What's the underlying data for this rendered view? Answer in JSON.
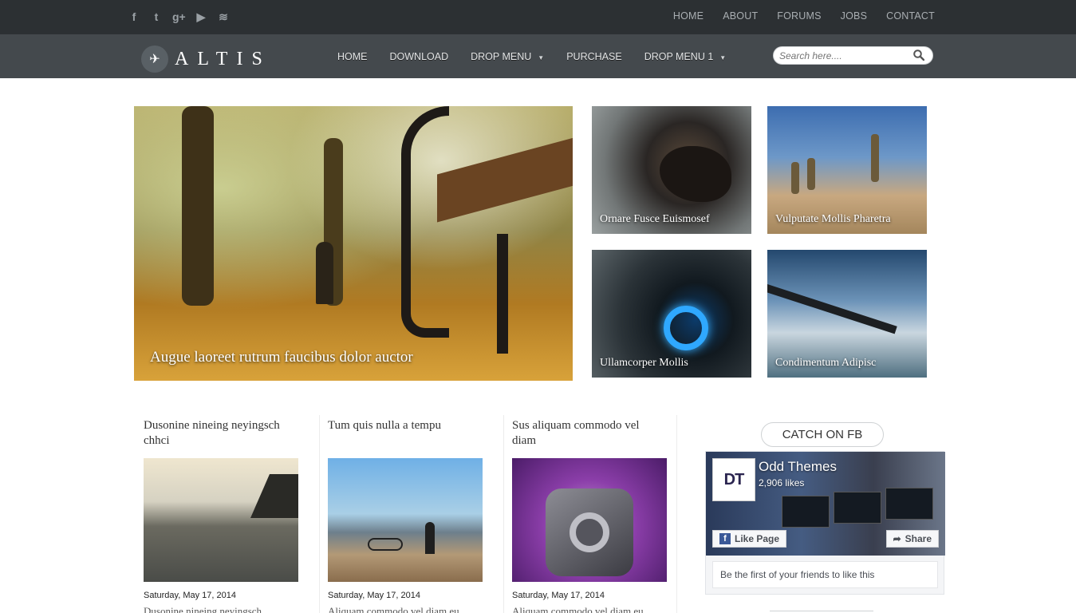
{
  "topbar": {
    "social": [
      {
        "icon": "facebook-icon",
        "glyph": "f"
      },
      {
        "icon": "twitter-icon",
        "glyph": "t"
      },
      {
        "icon": "google-plus-icon",
        "glyph": "g+"
      },
      {
        "icon": "youtube-icon",
        "glyph": "▶"
      },
      {
        "icon": "rss-icon",
        "glyph": "≋"
      }
    ],
    "links": [
      "HOME",
      "ABOUT",
      "FORUMS",
      "JOBS",
      "CONTACT"
    ]
  },
  "header": {
    "logo_text": "ALTIS",
    "nav": [
      {
        "label": "HOME",
        "dropdown": false
      },
      {
        "label": "DOWNLOAD",
        "dropdown": false
      },
      {
        "label": "DROP MENU",
        "dropdown": true
      },
      {
        "label": "PURCHASE",
        "dropdown": false
      },
      {
        "label": "DROP MENU 1",
        "dropdown": true
      }
    ],
    "search_placeholder": "Search here...."
  },
  "featured": {
    "main": {
      "caption": "Augue laoreet rutrum faucibus dolor auctor"
    },
    "small": [
      {
        "caption": "Ornare Fusce Euismosef"
      },
      {
        "caption": "Vulputate Mollis Pharetra"
      },
      {
        "caption": "Ullamcorper Mollis"
      },
      {
        "caption": "Condimentum Adipisc"
      }
    ]
  },
  "posts": [
    {
      "title": "Dusonine nineing neyingsch chhci",
      "date": "Saturday, May 17, 2014",
      "excerpt": "Dusonine nineing neyingsch"
    },
    {
      "title": "Tum quis nulla a tempu",
      "date": "Saturday, May 17, 2014",
      "excerpt": "Aliquam commodo vel diam eu"
    },
    {
      "title": "Sus aliquam commodo vel diam",
      "date": "Saturday, May 17, 2014",
      "excerpt": "Aliquam commodo vel diam eu"
    }
  ],
  "facebook": {
    "widget_title": "CATCH ON FB",
    "page_name": "Odd Themes",
    "logo_text": "DT",
    "likes": "2,906 likes",
    "like_label": "Like Page",
    "share_label": "Share",
    "friends_text": "Be the first of your friends to like this"
  }
}
